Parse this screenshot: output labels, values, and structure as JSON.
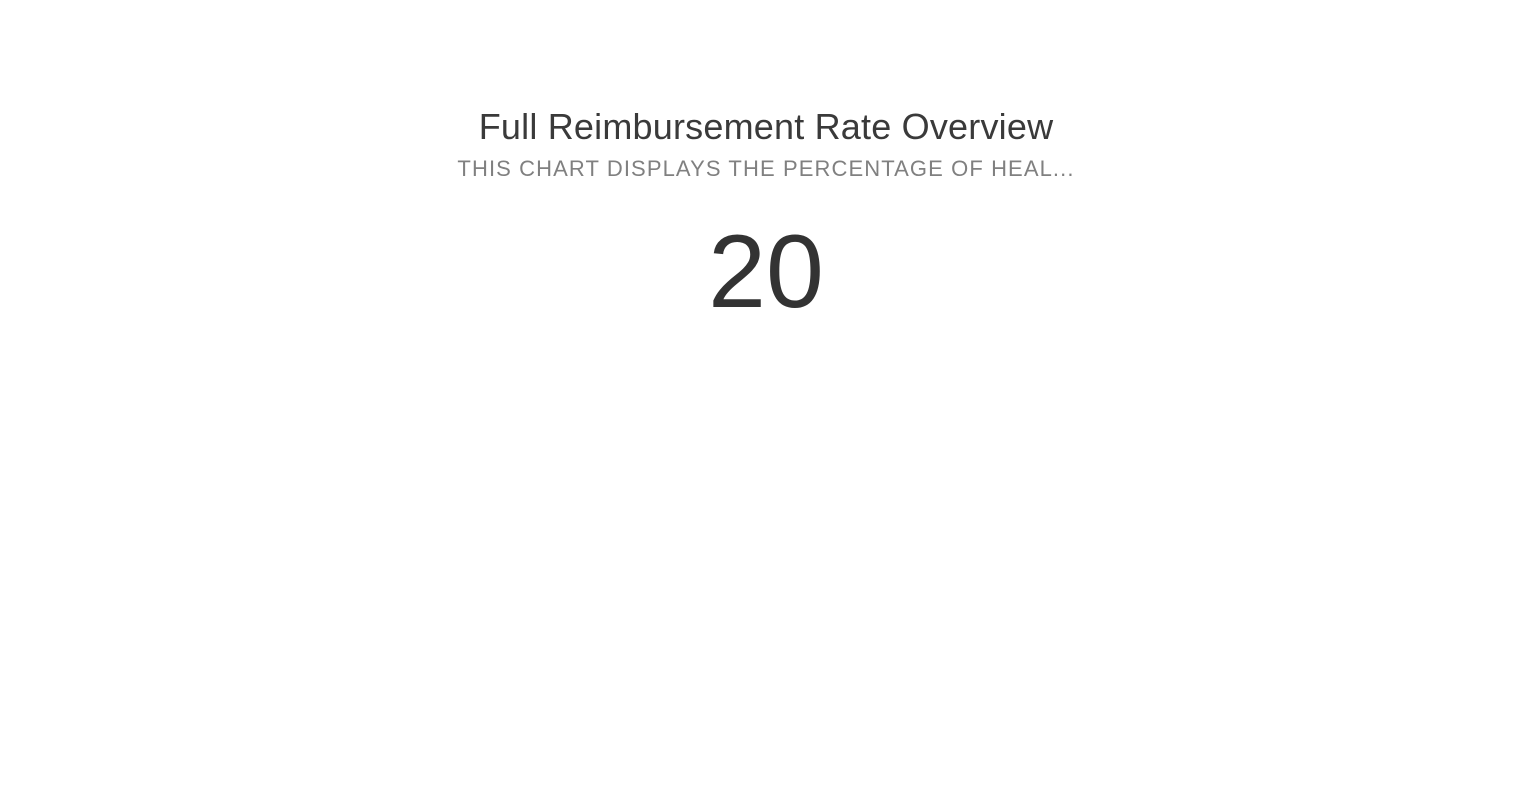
{
  "chart_data": {
    "type": "kpi",
    "title": "Full Reimbursement Rate Overview",
    "subtitle": "THIS CHART DISPLAYS THE PERCENTAGE OF HEAL...",
    "value": 20
  },
  "colors": {
    "background": "#ffffff",
    "title": "#3a3a3a",
    "subtitle": "#808080",
    "value": "#333333"
  }
}
